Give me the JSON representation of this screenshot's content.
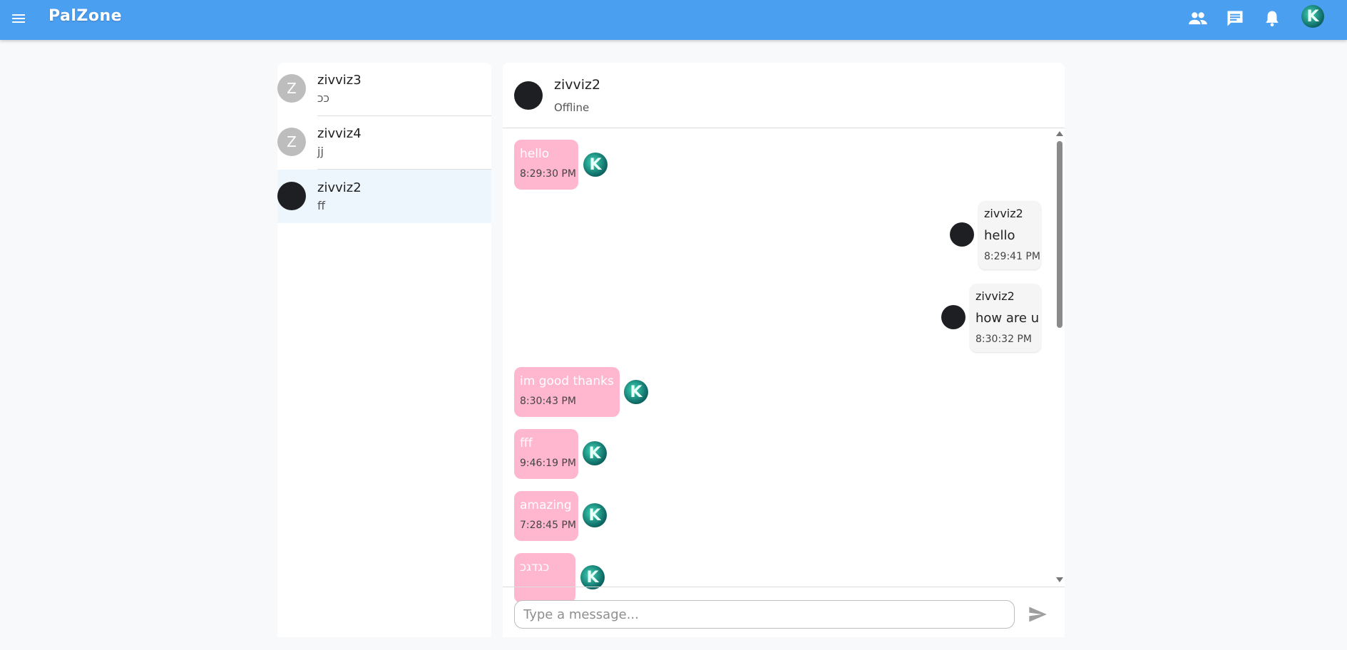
{
  "appbar": {
    "title": "PalZone",
    "color": "#4b9ff0",
    "icons": [
      "menu-icon",
      "friends-icon",
      "chat-icon",
      "notifications-icon"
    ],
    "avatar_letter": "K"
  },
  "conversations": [
    {
      "avatar_letter": "Z",
      "name": "zivviz3",
      "last_message": "ככ",
      "selected": false
    },
    {
      "avatar_letter": "Z",
      "name": "zivviz4",
      "last_message": "jj",
      "selected": false
    },
    {
      "avatar_letter": "",
      "name": "zivviz2",
      "last_message": "ff",
      "selected": true
    }
  ],
  "chat": {
    "header": {
      "name": "zivviz2",
      "status": "Offline"
    },
    "messages": [
      {
        "direction": "out",
        "text": "hello",
        "time": "8:29:30 PM"
      },
      {
        "direction": "in",
        "sender": "zivviz2",
        "text": "hello",
        "time": "8:29:41 PM"
      },
      {
        "direction": "in",
        "sender": "zivviz2",
        "text": "how are u",
        "time": "8:30:32 PM"
      },
      {
        "direction": "out",
        "text": "im good thanks",
        "time": "8:30:43 PM"
      },
      {
        "direction": "out",
        "text": "fff",
        "time": "9:46:19 PM"
      },
      {
        "direction": "out",
        "text": "amazing",
        "time": "7:28:45 PM"
      },
      {
        "direction": "out",
        "text": "כגדגכ",
        "time": ""
      }
    ],
    "input": {
      "placeholder": "Type a message...",
      "value": ""
    },
    "colors": {
      "outgoing_bubble": "#ffb6cf",
      "incoming_bubble": "#f5f5f5"
    }
  }
}
